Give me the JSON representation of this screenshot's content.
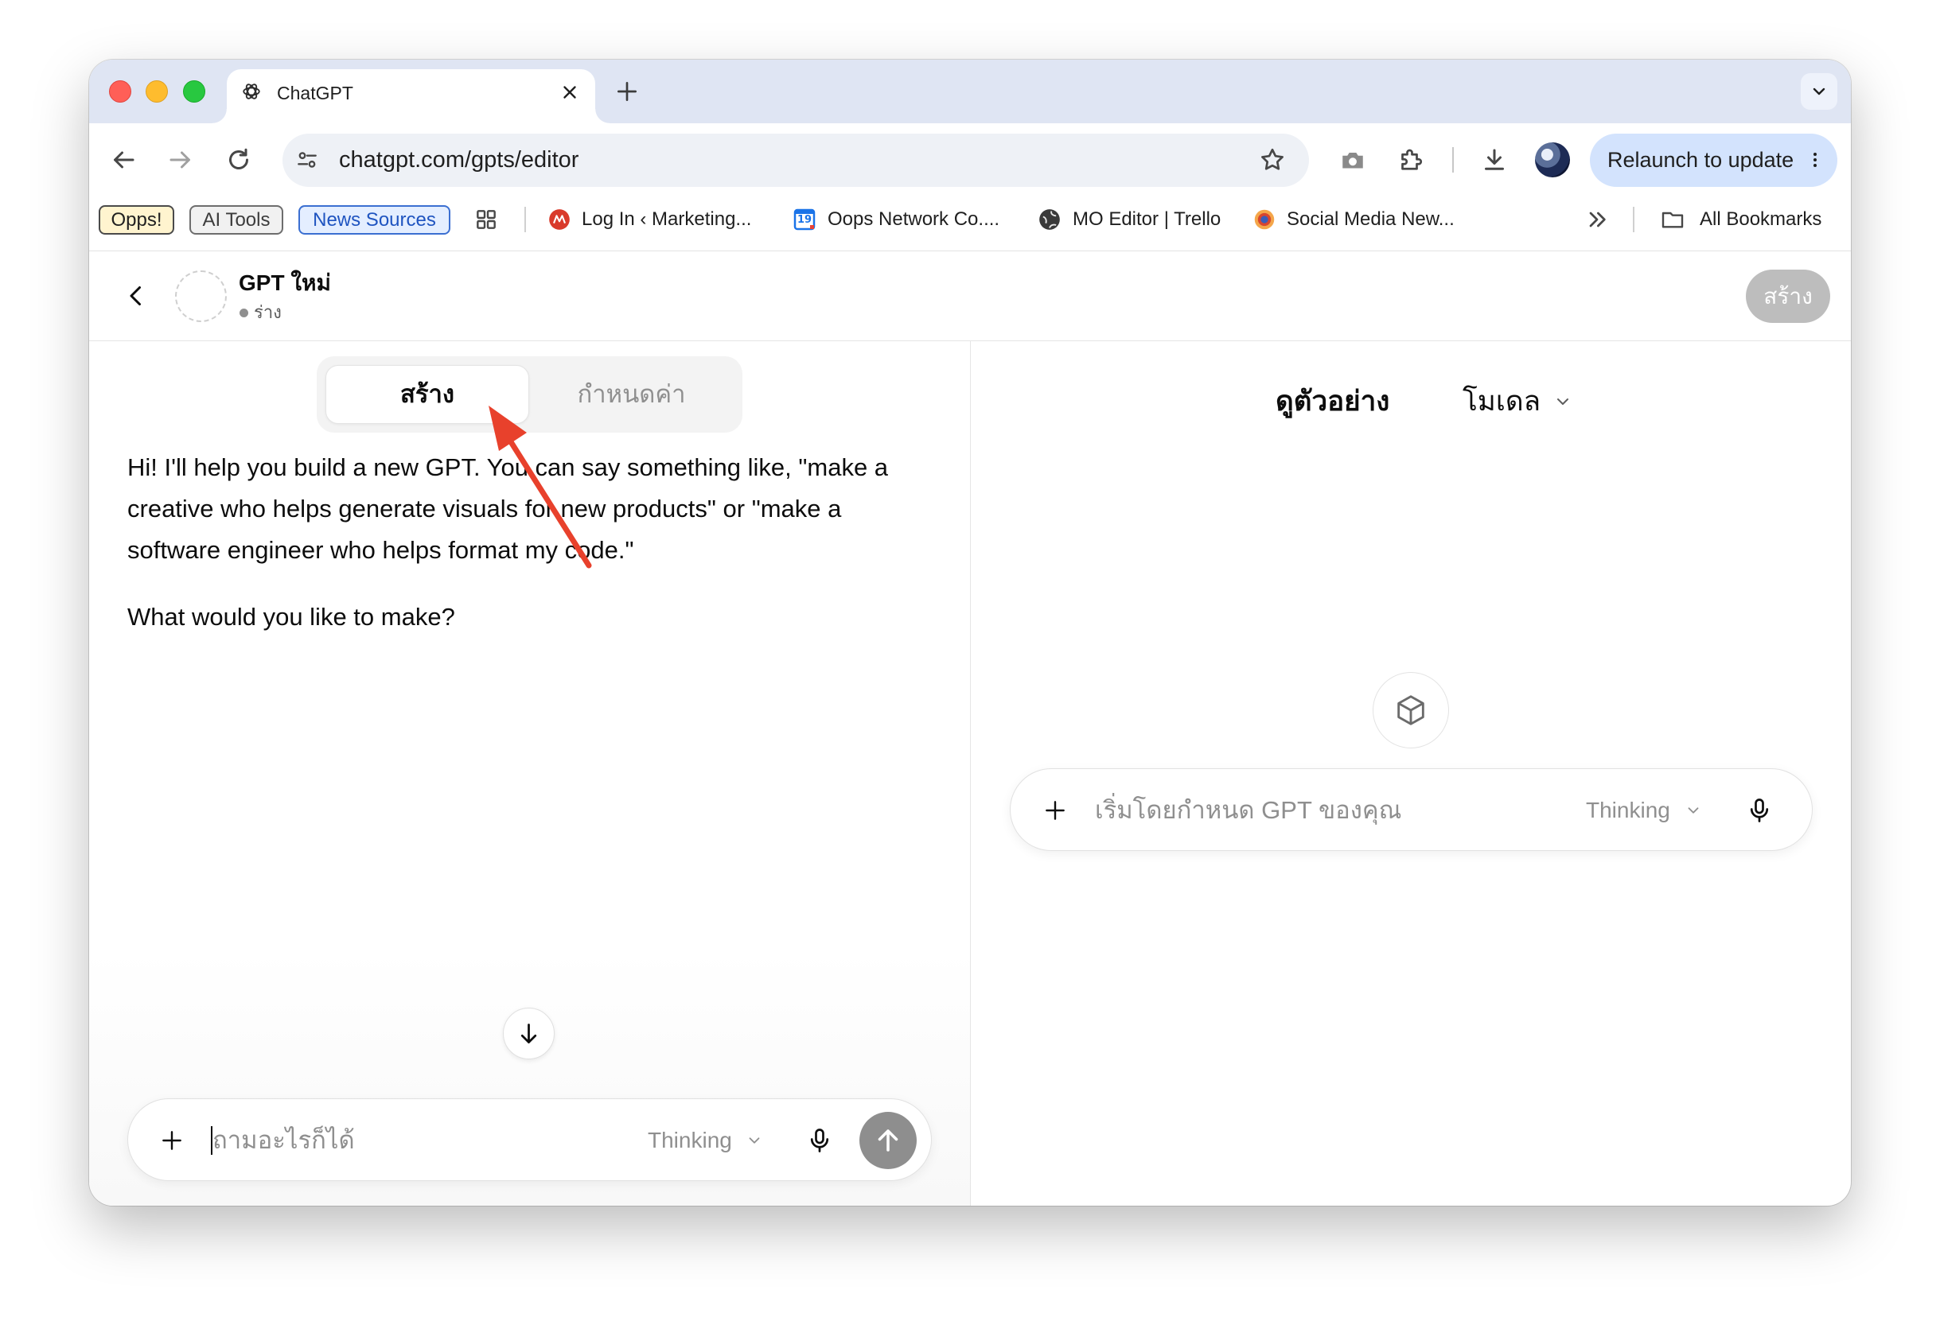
{
  "browser": {
    "tab": {
      "title": "ChatGPT",
      "icon": "chatgpt-logo-icon",
      "close_icon": "close-icon"
    },
    "new_tab_icon": "plus-icon",
    "address_bar": {
      "url": "chatgpt.com/gpts/editor",
      "site_icon": "site-info-icon",
      "bookmark_icon": "star-icon"
    },
    "toolbar": {
      "icons": [
        "back-arrow-icon",
        "forward-arrow-icon",
        "reload-icon",
        "camera-icon",
        "extensions-icon",
        "download-icon",
        "profile-avatar"
      ],
      "relaunch_label": "Relaunch to update"
    },
    "bookmarks": {
      "chips": [
        "Opps!",
        "AI Tools",
        "News Sources"
      ],
      "links": [
        {
          "label": "Log In ‹ Marketing...",
          "icon": "marketing-favicon-icon"
        },
        {
          "label": "Oops Network Co....",
          "icon": "calendar-icon",
          "icon_text": "19"
        },
        {
          "label": "MO Editor | Trello",
          "icon": "globe-icon"
        },
        {
          "label": "Social Media New...",
          "icon": "social-media-favicon-icon"
        }
      ],
      "all_bookmarks_label": "All Bookmarks"
    }
  },
  "header": {
    "title": "GPT ใหม่",
    "status": "ร่าง",
    "create_button": "สร้าง"
  },
  "editor": {
    "tabs": [
      {
        "label": "สร้าง",
        "active": true
      },
      {
        "label": "กำหนดค่า",
        "active": false
      }
    ],
    "message": {
      "lines": [
        "Hi! I'll help you build a new GPT. You can say something like, \"make a",
        "creative who helps generate visuals for new products\" or \"make a",
        "software engineer who helps format my code.\""
      ],
      "question": "What would you like to make?"
    },
    "composer": {
      "placeholder": "ถามอะไรก็ได้",
      "mode": "Thinking"
    }
  },
  "preview": {
    "title": "ดูตัวอย่าง",
    "model_label": "โมเดล",
    "composer": {
      "placeholder": "เริ่มโดยกำหนด GPT ของคุณ",
      "mode": "Thinking"
    }
  },
  "colors": {
    "tabstrip": "#dfe5f3",
    "omnibox": "#eef1f6",
    "relaunch": "#d3e3fd",
    "arrow": "#e8412c",
    "createbtn": "#bdbdbd",
    "sendbtn": "#8e8e8e"
  }
}
